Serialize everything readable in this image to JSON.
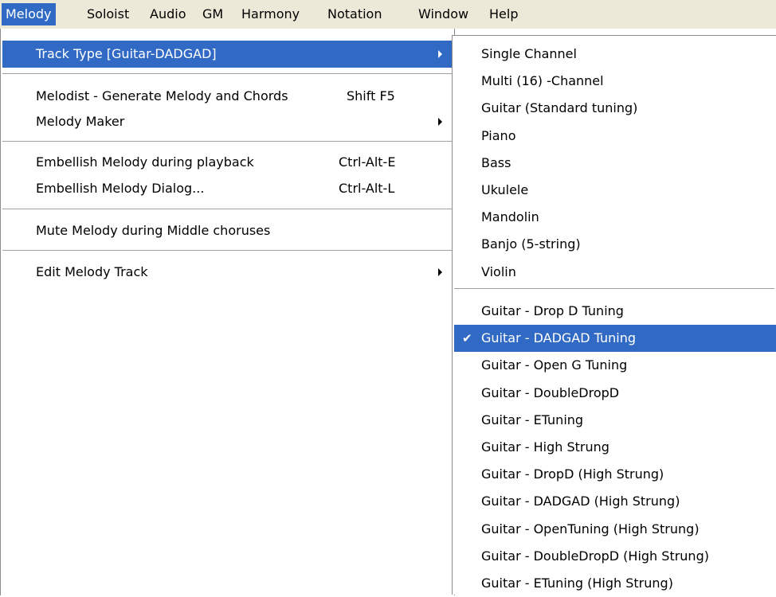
{
  "menubar": {
    "items": [
      "Melody",
      "Soloist",
      "Audio",
      "GM",
      "Harmony",
      "Notation",
      "Window",
      "Help"
    ]
  },
  "main_menu": {
    "track_type": "Track Type [Guitar-DADGAD]",
    "melodist": "Melodist - Generate Melody and Chords",
    "melodist_shortcut": "Shift F5",
    "melody_maker": "Melody Maker",
    "embellish_playback": "Embellish Melody during playback",
    "embellish_playback_shortcut": "Ctrl-Alt-E",
    "embellish_dialog": "Embellish Melody Dialog...",
    "embellish_dialog_shortcut": "Ctrl-Alt-L",
    "mute_middle": "Mute Melody during Middle choruses",
    "edit_track": "Edit Melody Track"
  },
  "sub_menu": {
    "group1": [
      "Single Channel",
      "Multi (16) -Channel",
      "Guitar (Standard tuning)",
      "Piano",
      "Bass",
      "Ukulele",
      "Mandolin",
      "Banjo (5-string)",
      "Violin"
    ],
    "group2": [
      "Guitar - Drop D Tuning",
      "Guitar - DADGAD Tuning",
      "Guitar - Open G Tuning",
      "Guitar - DoubleDropD",
      "Guitar - ETuning",
      "Guitar - High Strung",
      "Guitar - DropD (High Strung)",
      "Guitar - DADGAD (High Strung)",
      "Guitar - OpenTuning (High Strung)",
      "Guitar - DoubleDropD (High Strung)",
      "Guitar - ETuning (High Strung)"
    ],
    "checked_item": "Guitar - DADGAD Tuning",
    "check_glyph": "✔"
  },
  "colors": {
    "highlight": "#316ac5",
    "menubar": "#ece9d8"
  }
}
